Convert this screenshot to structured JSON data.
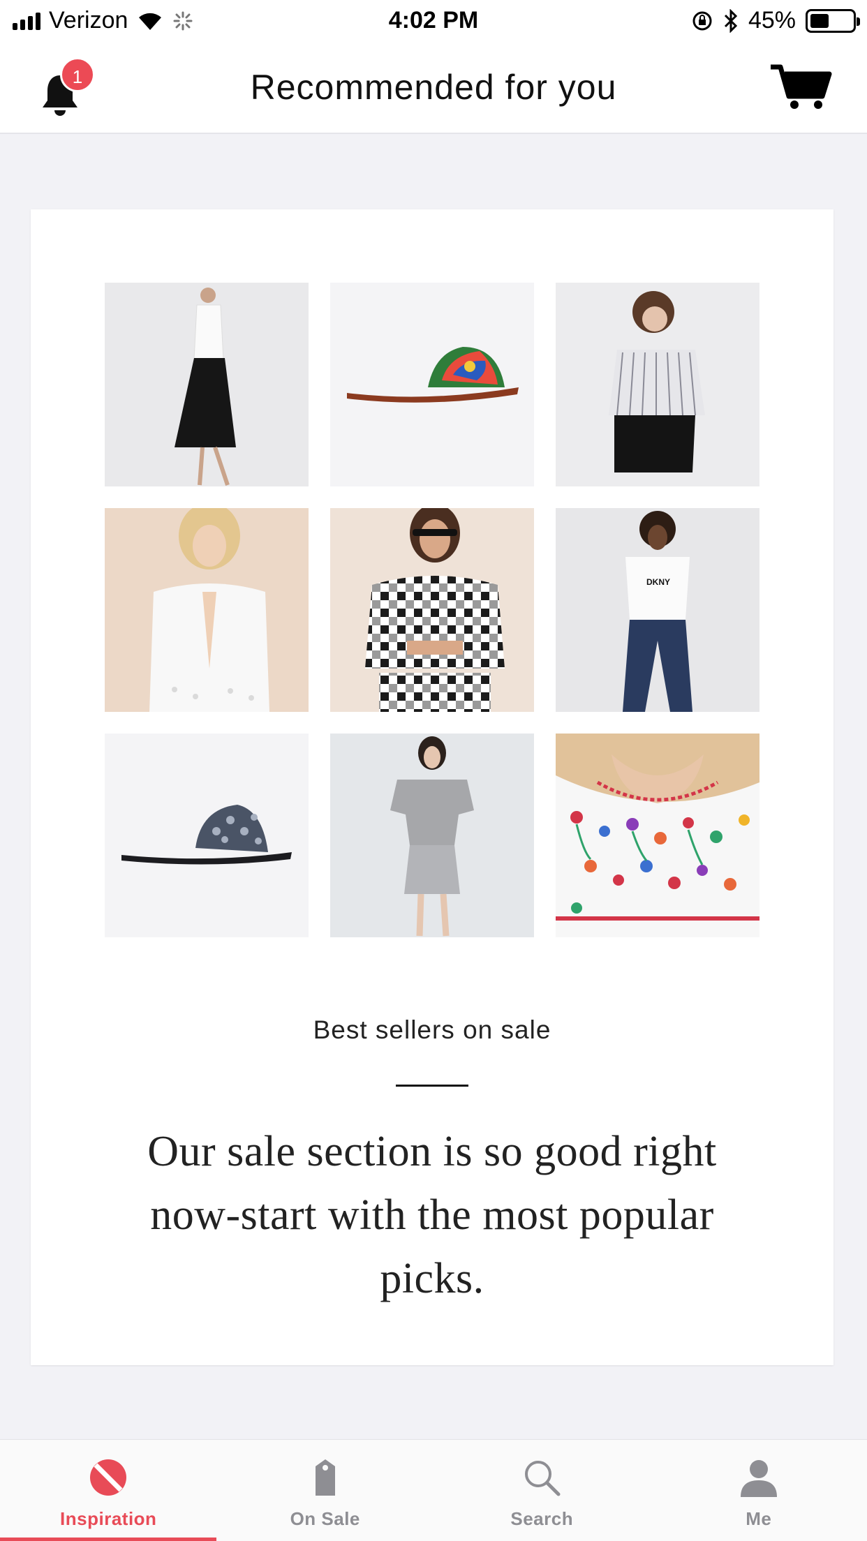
{
  "status_bar": {
    "carrier": "Verizon",
    "time": "4:02 PM",
    "battery_percent_label": "45%",
    "battery_level": 0.45
  },
  "header": {
    "title": "Recommended for you",
    "notification_count": "1",
    "accent_color": "#ec4a55"
  },
  "products": [
    {
      "name": "white-blouse-black-pleated-skirt"
    },
    {
      "name": "embroidered-flat-slide-sandal"
    },
    {
      "name": "striped-cropped-shirt"
    },
    {
      "name": "white-eyelet-tie-top"
    },
    {
      "name": "gingham-off-shoulder-set"
    },
    {
      "name": "dkny-logo-tee-jeans"
    },
    {
      "name": "embellished-slide-sandal"
    },
    {
      "name": "grey-tshirt-dress"
    },
    {
      "name": "floral-embroidered-blouse"
    }
  ],
  "section": {
    "label": "Best sellers on sale",
    "body": "Our sale section is so good right now-start with the most popular picks."
  },
  "tabs": [
    {
      "label": "Inspiration",
      "icon": "inspiration-icon",
      "active": true
    },
    {
      "label": "On Sale",
      "icon": "tag-icon",
      "active": false
    },
    {
      "label": "Search",
      "icon": "search-icon",
      "active": false
    },
    {
      "label": "Me",
      "icon": "person-icon",
      "active": false
    }
  ],
  "colors": {
    "active_tab": "#e84b57",
    "inactive_tab": "#8e8e93"
  }
}
